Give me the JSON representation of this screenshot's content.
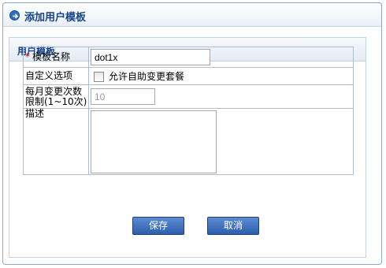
{
  "window": {
    "title": "添加用户模板"
  },
  "panel": {
    "title": "用户模板"
  },
  "form": {
    "name_label": "模板名称",
    "required_mark": "*",
    "name_value": "dot1x",
    "custom_label": "自定义选项",
    "allow_self_change_label": "允许自助变更套餐",
    "allow_self_change_checked": false,
    "limit_label_line1": "每月变更次数",
    "limit_label_line2": "限制(1~10次)",
    "limit_value": "10",
    "desc_label": "描述",
    "desc_value": ""
  },
  "buttons": {
    "save": "保存",
    "cancel": "取消"
  }
}
